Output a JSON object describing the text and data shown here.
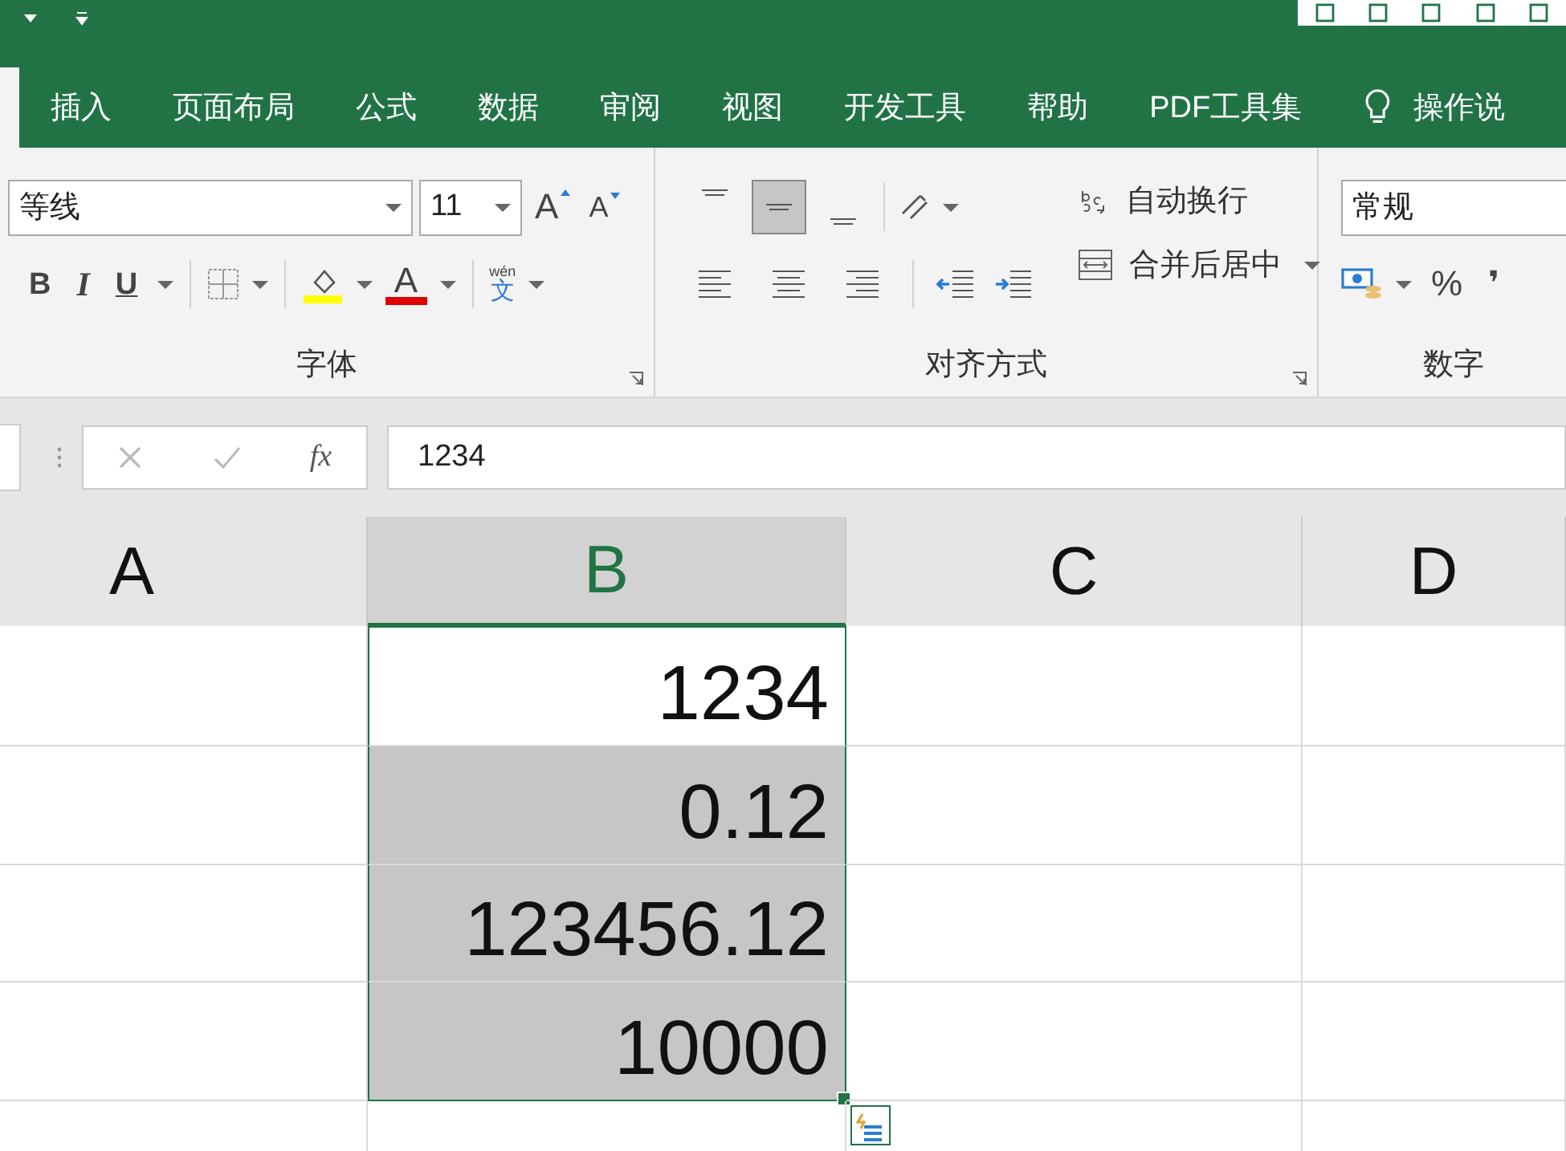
{
  "tabs": [
    {
      "label": "插入",
      "selected": false
    },
    {
      "label": "页面布局",
      "selected": false
    },
    {
      "label": "公式",
      "selected": false
    },
    {
      "label": "数据",
      "selected": false
    },
    {
      "label": "审阅",
      "selected": false
    },
    {
      "label": "视图",
      "selected": false
    },
    {
      "label": "开发工具",
      "selected": false
    },
    {
      "label": "帮助",
      "selected": false
    },
    {
      "label": "PDF工具集",
      "selected": false
    }
  ],
  "tell_me": "操作说",
  "font_group": {
    "font_name": "等线",
    "font_size": "11",
    "grow": "A",
    "shrink": "A",
    "bold": "B",
    "italic": "I",
    "underline": "U",
    "font_color_letter": "A",
    "phonetic_top": "wén",
    "phonetic_bottom": "文",
    "label": "字体"
  },
  "alignment_group": {
    "vertical_align": [
      {
        "selected": false
      },
      {
        "selected": true
      },
      {
        "selected": false
      }
    ],
    "horizontal_align": [
      {
        "selected": false
      },
      {
        "selected": false
      },
      {
        "selected": false
      }
    ],
    "wrap_text": "自动换行",
    "merge_center": "合并后居中",
    "label": "对齐方式"
  },
  "number_group": {
    "format": "常规",
    "percent": "%",
    "comma": "❜",
    "label": "数字"
  },
  "formula_bar": {
    "fx": "fx",
    "value": "1234"
  },
  "columns": [
    {
      "label": "A",
      "selected": false
    },
    {
      "label": "B",
      "selected": true
    },
    {
      "label": "C",
      "selected": false
    },
    {
      "label": "D",
      "selected": false
    }
  ],
  "rows": [
    {
      "b": "1234",
      "selected": true,
      "active": true
    },
    {
      "b": "0.12",
      "selected": true,
      "active": false
    },
    {
      "b": "123456.12",
      "selected": true,
      "active": false
    },
    {
      "b": "10000",
      "selected": true,
      "active": false
    },
    {
      "b": "",
      "selected": false,
      "active": false
    }
  ]
}
